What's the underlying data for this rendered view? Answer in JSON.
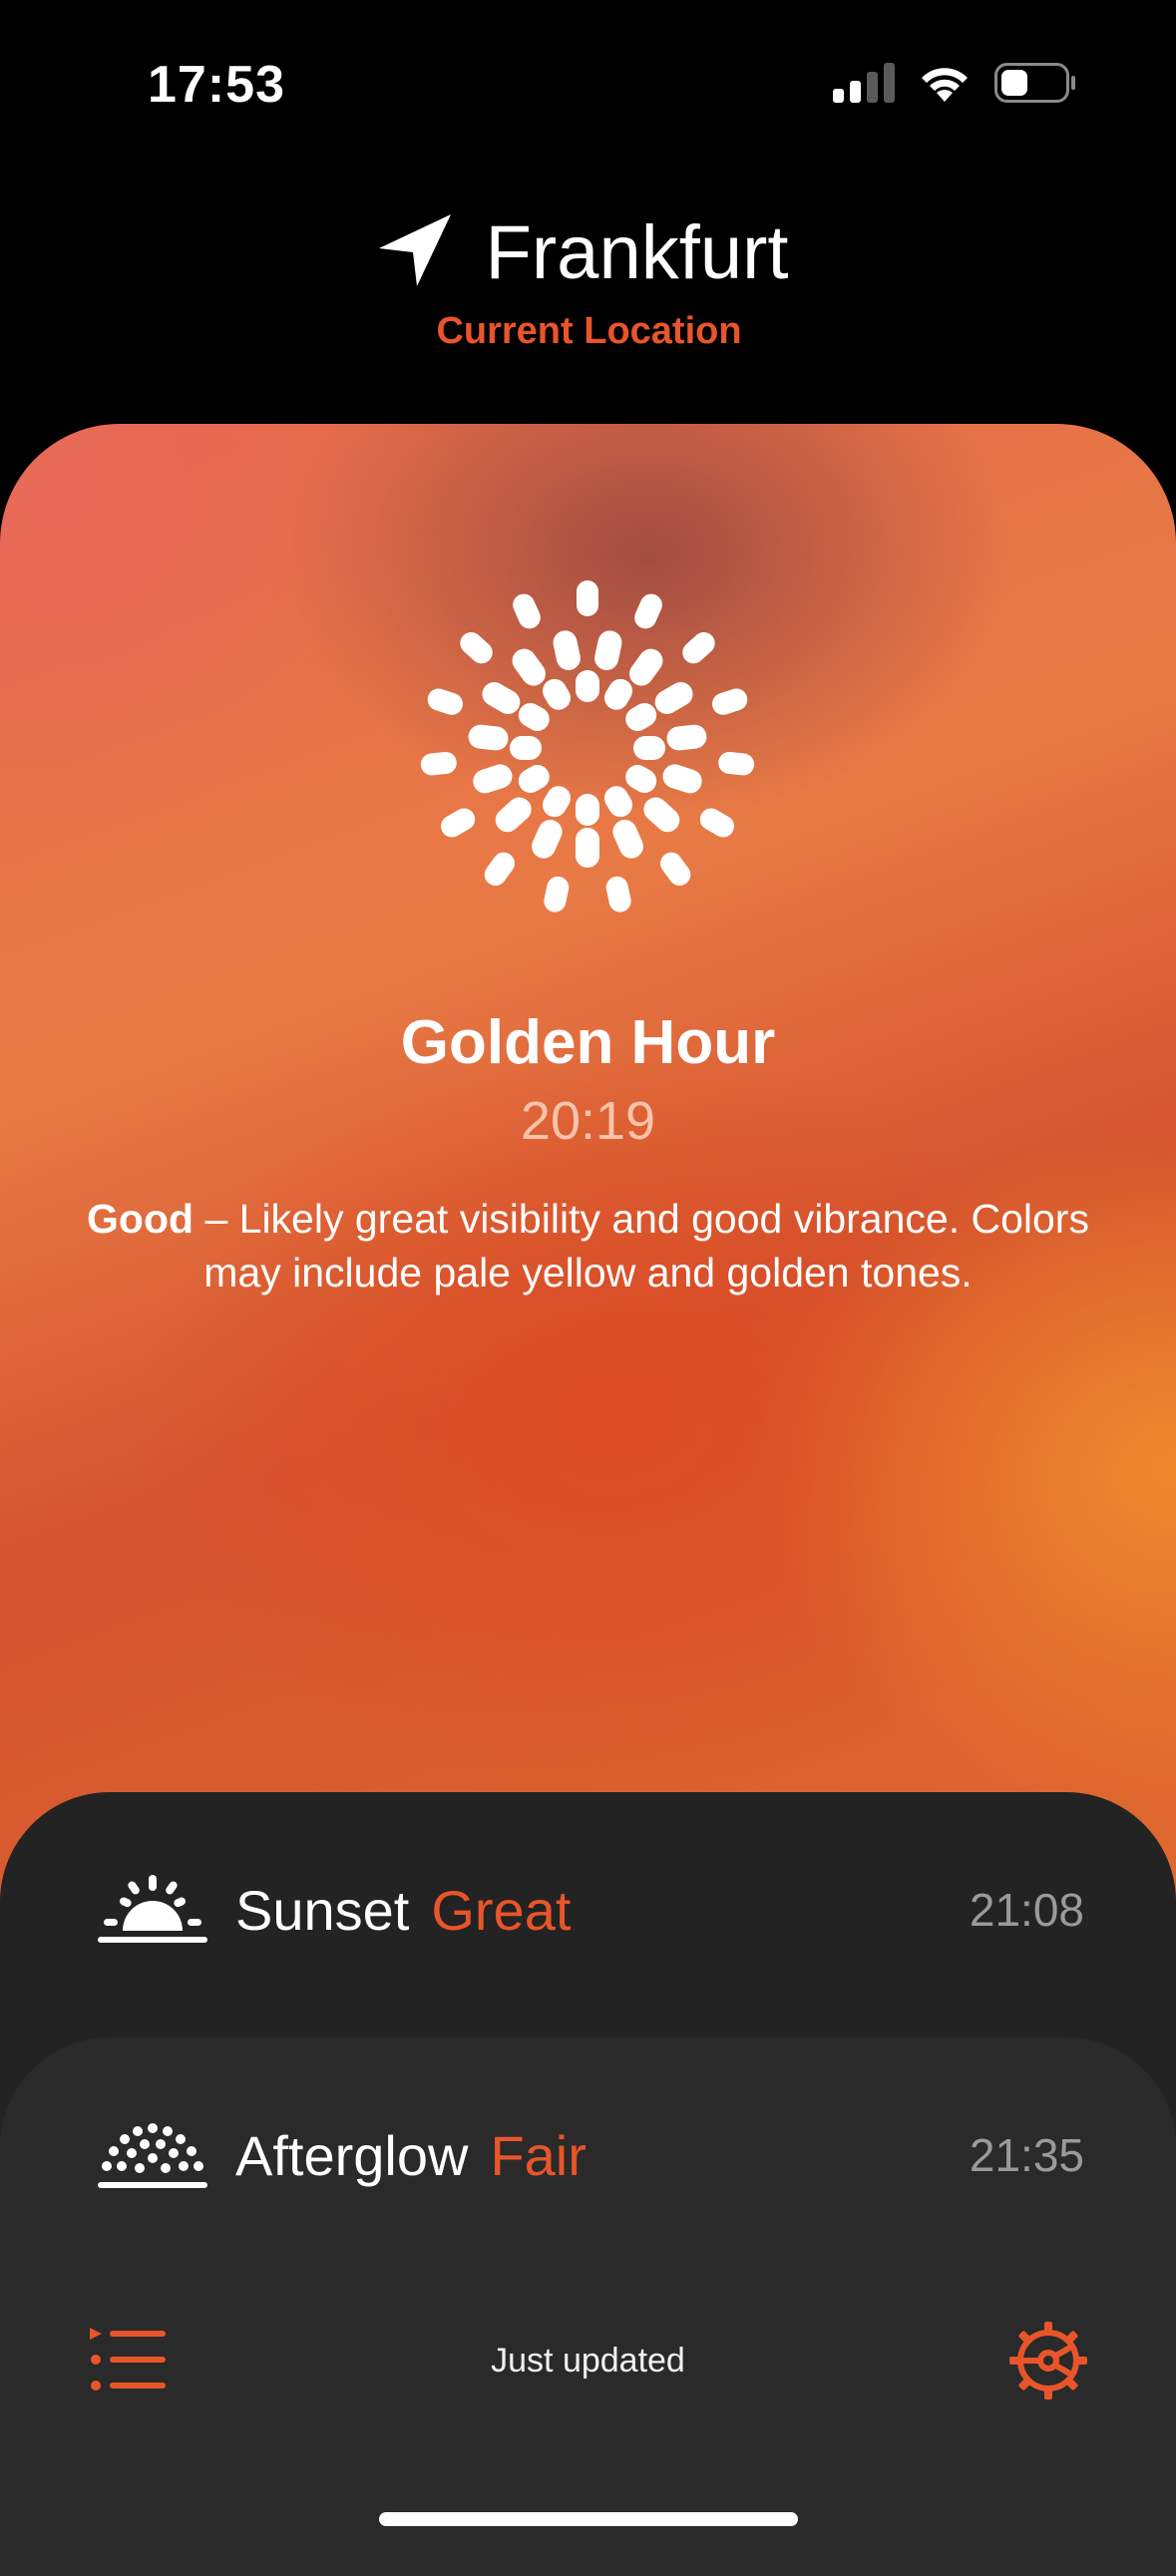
{
  "status_bar": {
    "time": "17:53",
    "icons": [
      "cellular-signal-icon",
      "wifi-icon",
      "battery-icon"
    ]
  },
  "location": {
    "name": "Frankfurt",
    "subtitle": "Current Location",
    "icon": "location-arrow-icon"
  },
  "hero": {
    "icon": "golden-hour-sun-icon",
    "title": "Golden Hour",
    "time": "20:19",
    "rating": "Good",
    "description": " – Likely great visibility and good vibrance. Colors may include pale yellow and golden tones."
  },
  "events": [
    {
      "icon": "sunset-icon",
      "label": "Sunset",
      "rating": "Great",
      "time": "21:08"
    },
    {
      "icon": "afterglow-icon",
      "label": "Afterglow",
      "rating": "Fair",
      "time": "21:35"
    }
  ],
  "footer": {
    "status": "Just updated",
    "list_icon": "list-icon",
    "settings_icon": "settings-gear-icon"
  },
  "colors": {
    "accent": "#e8552a",
    "background": "#000000",
    "card": "#232323"
  }
}
